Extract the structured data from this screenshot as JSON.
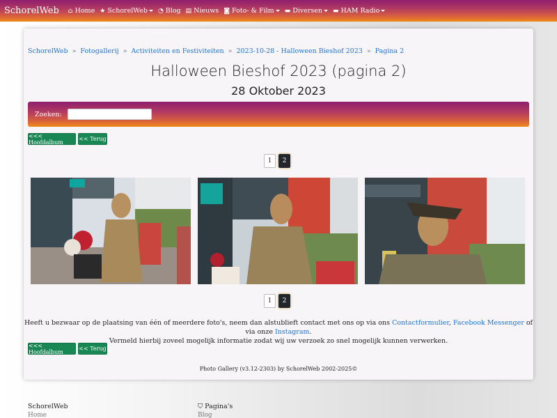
{
  "navbar": {
    "brand": "SchorelWeb",
    "items": [
      {
        "label": "Home",
        "icon": "home-icon",
        "dropdown": false
      },
      {
        "label": "SchorelWeb",
        "icon": "star-icon",
        "dropdown": true
      },
      {
        "label": "Blog",
        "icon": "rss-icon",
        "dropdown": false
      },
      {
        "label": "Nieuws",
        "icon": "newspaper-icon",
        "dropdown": false
      },
      {
        "label": "Foto- & Film",
        "icon": "camera-icon",
        "dropdown": true
      },
      {
        "label": "Diversen",
        "icon": "folder-icon",
        "dropdown": true
      },
      {
        "label": "HAM Radio",
        "icon": "folder-icon",
        "dropdown": true
      }
    ]
  },
  "breadcrumb": [
    "SchorelWeb",
    "Fotogallerij",
    "Activiteiten en Festiviteiten",
    "2023-10-28 - Halloween Bieshof 2023",
    "Pagina 2"
  ],
  "breadcrumb_sep": "»",
  "page": {
    "title": "Halloween Bieshof 2023 (pagina 2)",
    "subtitle": "28 Oktober 2023"
  },
  "search": {
    "label": "Zoeken:",
    "value": "",
    "placeholder": ""
  },
  "buttons": {
    "main_album": "<<< Hoofdalbum",
    "back": "<< Terug"
  },
  "pagination": {
    "pages": [
      "1",
      "2"
    ],
    "current": "2"
  },
  "notice": {
    "before": "Heeft u bezwaar op de plaatsing van één of meerdere foto's, neem dan alstublieft contact met ons op via ons ",
    "link1": "Contactformulier",
    "mid1": ", ",
    "link2": "Facebook Messenger",
    "mid2": " of via onze ",
    "link3": "Instagram",
    "after": ".",
    "line2": "Vermeld hierbij zoveel mogelijk informatie zodat wij uw verzoek zo snel mogelijk kunnen verwerken."
  },
  "credit": "Photo Gallery (v3.12-2303) by SchorelWeb 2002-2025©",
  "footer": {
    "col1_title": "SchorelWeb",
    "col1_item": "Home",
    "col2_title": "Pagina's",
    "col2_icon": "shield-icon",
    "col2_item": "Blog"
  },
  "colors": {
    "accent_link": "#1a73d1",
    "button_green": "#198754",
    "gradient_top": "#8e1f6e",
    "gradient_bottom": "#f08a1a"
  }
}
